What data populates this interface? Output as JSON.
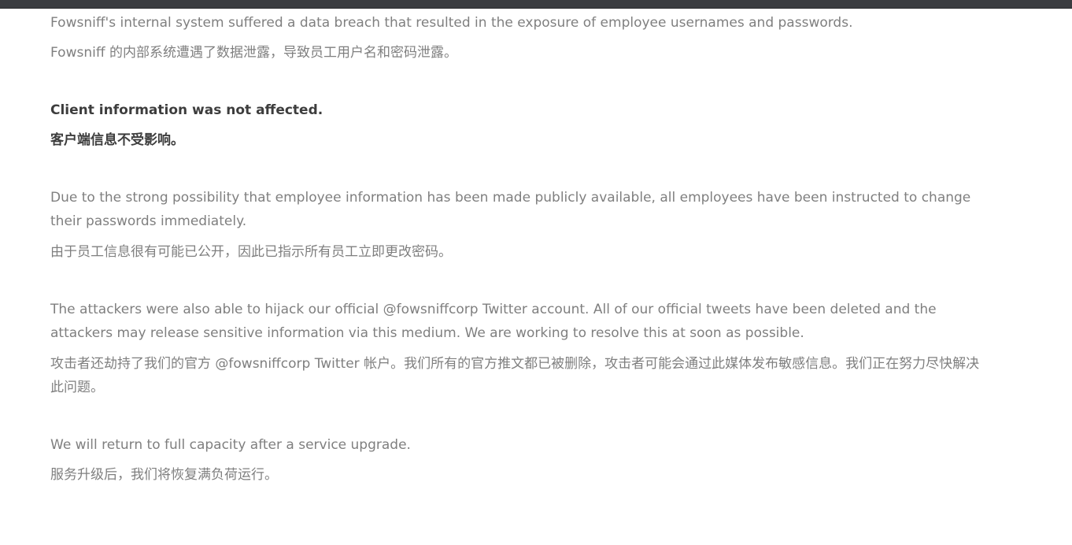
{
  "notice": {
    "breach_en": "Fowsniff's internal system suffered a data breach that resulted in the exposure of employee usernames and passwords.",
    "breach_zh": "Fowsniff 的内部系统遭遇了数据泄露，导致员工用户名和密码泄露。",
    "client_en": "Client information was not affected.",
    "client_zh": "客户端信息不受影响。",
    "passwords_en": "Due to the strong possibility that employee information has been made publicly available, all employees have been instructed to change their passwords immediately.",
    "passwords_zh": "由于员工信息很有可能已公开，因此已指示所有员工立即更改密码。",
    "twitter_en": "The attackers were also able to hijack our official @fowsniffcorp Twitter account. All of our official tweets have been deleted and the attackers may release sensitive information via this medium. We are working to resolve this at soon as possible.",
    "twitter_zh": "攻击者还劫持了我们的官方 @fowsniffcorp Twitter 帐户。我们所有的官方推文都已被删除，攻击者可能会通过此媒体发布敏感信息。我们正在努力尽快解决此问题。",
    "capacity_en": "We will return to full capacity after a service upgrade.",
    "capacity_zh": "服务升级后，我们将恢复满负荷运行。"
  }
}
